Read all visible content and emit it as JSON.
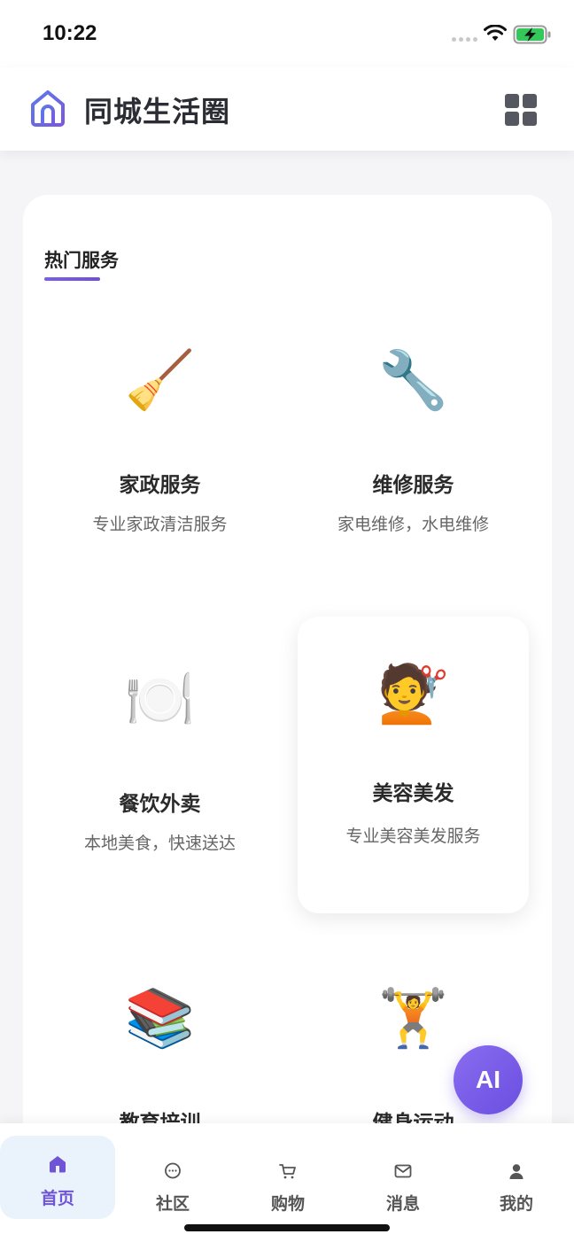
{
  "status_bar": {
    "time": "10:22"
  },
  "header": {
    "title": "同城生活圈",
    "logo_icon": "home-icon",
    "menu_icon": "grid-icon",
    "accent_color": "#6f55d6"
  },
  "section": {
    "title": "热门服务"
  },
  "services": [
    {
      "emoji": "🧹",
      "icon": "broom-icon",
      "name": "家政服务",
      "desc": "专业家政清洁服务"
    },
    {
      "emoji": "🔧",
      "icon": "wrench-icon",
      "name": "维修服务",
      "desc": "家电维修，水电维修"
    },
    {
      "emoji": "🍽️",
      "icon": "plate-cutlery-icon",
      "name": "餐饮外卖",
      "desc": "本地美食，快速送达"
    },
    {
      "emoji": "💇",
      "icon": "haircut-icon",
      "name": "美容美发",
      "desc": "专业美容美发服务"
    },
    {
      "emoji": "📚",
      "icon": "books-icon",
      "name": "教育培训",
      "desc": ""
    },
    {
      "emoji": "🏋️",
      "icon": "weightlifter-icon",
      "name": "健身运动",
      "desc": ""
    }
  ],
  "ai_button": {
    "label": "AI"
  },
  "nav": {
    "items": [
      {
        "label": "首页",
        "icon": "home-icon",
        "active": true
      },
      {
        "label": "社区",
        "icon": "chat-bubble-icon"
      },
      {
        "label": "购物",
        "icon": "cart-icon"
      },
      {
        "label": "消息",
        "icon": "mail-icon"
      },
      {
        "label": "我的",
        "icon": "user-icon"
      }
    ]
  }
}
